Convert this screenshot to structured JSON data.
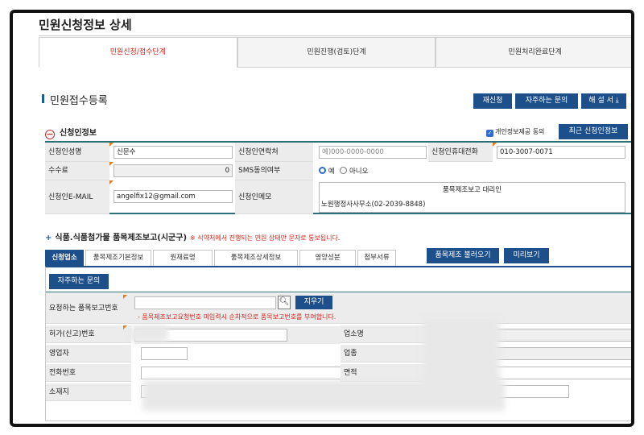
{
  "page": {
    "title": "민원신청정보 상세"
  },
  "top_tabs": [
    {
      "label": "민원신청/접수단계",
      "active": true
    },
    {
      "label": "민원진행(검토)단계",
      "active": false
    },
    {
      "label": "민원처리완료단계",
      "active": false
    }
  ],
  "section": {
    "title": "민원접수등록"
  },
  "actions": {
    "reapply": "재신청",
    "faq": "자주하는 문의",
    "manual": "해 설 서 ⤓"
  },
  "applicant": {
    "title": "신청인정보",
    "consent_label": "개인정보제공 동의",
    "recent_button": "최근 신청인정보",
    "name_label": "신청인성명",
    "name_value": "신문수",
    "contact_label": "신청인연락처",
    "contact_placeholder": "예)000-0000-0000",
    "mobile_label": "신청인휴대전화",
    "mobile_value": "010-3007-0071",
    "fee_label": "수수료",
    "fee_value": "0",
    "sms_label": "SMS동의여부",
    "sms_yes": "예",
    "sms_no": "아니오",
    "email_label": "신청인E-MAIL",
    "email_value": "angelfix12@gmail.com",
    "memo_label": "신청인메모",
    "memo_line1": "품목제조보고 대리인",
    "memo_line2": "노원행정사사무소(02-2039-8848)"
  },
  "food": {
    "title": "식품.식품첨가물 품목제조보고(시군구)",
    "note": "※ 식약처에서 진행되는 민원 상태만 문자로 통보됩니다."
  },
  "sub_tabs": [
    {
      "label": "신청업소",
      "active": true
    },
    {
      "label": "품목제조기본정보",
      "active": false
    },
    {
      "label": "원재료명",
      "active": false
    },
    {
      "label": "품목제조상세정보",
      "active": false
    },
    {
      "label": "영양성분",
      "active": false
    },
    {
      "label": "첨부서류",
      "active": false
    }
  ],
  "sub_actions": {
    "load": "품목제조 불러오기",
    "preview": "미리보기"
  },
  "panel": {
    "faq_button": "자주하는 문의",
    "report_no_label": "요청하는 품목보고번호",
    "search_icon": "search-icon",
    "clear_button": "지우기",
    "report_note": "- 품목제조보고요청번호 미입력시 순차적으로 품목보고번호를 부여합니다.",
    "permit_label": "허가(신고)번호",
    "business_name_label": "업소명",
    "operator_label": "영업자",
    "business_type_label": "업종",
    "phone_label": "전화번호",
    "area_label": "면적",
    "address_label": "소재지"
  },
  "colors": {
    "accent": "#1d4f8b",
    "active_tab_text": "#d0241c",
    "border_teal": "#2a6f7a"
  }
}
